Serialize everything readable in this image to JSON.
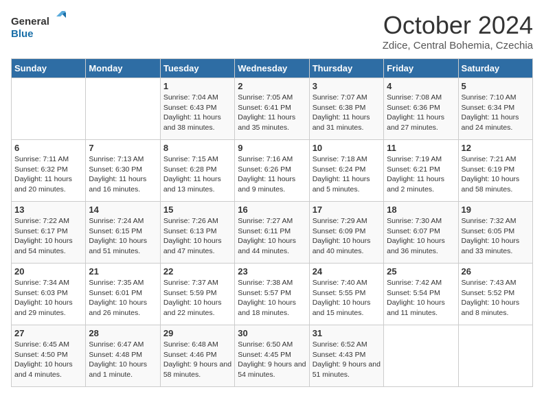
{
  "logo": {
    "general": "General",
    "blue": "Blue"
  },
  "title": "October 2024",
  "subtitle": "Zdice, Central Bohemia, Czechia",
  "days_of_week": [
    "Sunday",
    "Monday",
    "Tuesday",
    "Wednesday",
    "Thursday",
    "Friday",
    "Saturday"
  ],
  "weeks": [
    [
      null,
      null,
      {
        "day": 1,
        "sunrise": "7:04 AM",
        "sunset": "6:43 PM",
        "daylight": "11 hours and 38 minutes."
      },
      {
        "day": 2,
        "sunrise": "7:05 AM",
        "sunset": "6:41 PM",
        "daylight": "11 hours and 35 minutes."
      },
      {
        "day": 3,
        "sunrise": "7:07 AM",
        "sunset": "6:38 PM",
        "daylight": "11 hours and 31 minutes."
      },
      {
        "day": 4,
        "sunrise": "7:08 AM",
        "sunset": "6:36 PM",
        "daylight": "11 hours and 27 minutes."
      },
      {
        "day": 5,
        "sunrise": "7:10 AM",
        "sunset": "6:34 PM",
        "daylight": "11 hours and 24 minutes."
      }
    ],
    [
      {
        "day": 6,
        "sunrise": "7:11 AM",
        "sunset": "6:32 PM",
        "daylight": "11 hours and 20 minutes."
      },
      {
        "day": 7,
        "sunrise": "7:13 AM",
        "sunset": "6:30 PM",
        "daylight": "11 hours and 16 minutes."
      },
      {
        "day": 8,
        "sunrise": "7:15 AM",
        "sunset": "6:28 PM",
        "daylight": "11 hours and 13 minutes."
      },
      {
        "day": 9,
        "sunrise": "7:16 AM",
        "sunset": "6:26 PM",
        "daylight": "11 hours and 9 minutes."
      },
      {
        "day": 10,
        "sunrise": "7:18 AM",
        "sunset": "6:24 PM",
        "daylight": "11 hours and 5 minutes."
      },
      {
        "day": 11,
        "sunrise": "7:19 AM",
        "sunset": "6:21 PM",
        "daylight": "11 hours and 2 minutes."
      },
      {
        "day": 12,
        "sunrise": "7:21 AM",
        "sunset": "6:19 PM",
        "daylight": "10 hours and 58 minutes."
      }
    ],
    [
      {
        "day": 13,
        "sunrise": "7:22 AM",
        "sunset": "6:17 PM",
        "daylight": "10 hours and 54 minutes."
      },
      {
        "day": 14,
        "sunrise": "7:24 AM",
        "sunset": "6:15 PM",
        "daylight": "10 hours and 51 minutes."
      },
      {
        "day": 15,
        "sunrise": "7:26 AM",
        "sunset": "6:13 PM",
        "daylight": "10 hours and 47 minutes."
      },
      {
        "day": 16,
        "sunrise": "7:27 AM",
        "sunset": "6:11 PM",
        "daylight": "10 hours and 44 minutes."
      },
      {
        "day": 17,
        "sunrise": "7:29 AM",
        "sunset": "6:09 PM",
        "daylight": "10 hours and 40 minutes."
      },
      {
        "day": 18,
        "sunrise": "7:30 AM",
        "sunset": "6:07 PM",
        "daylight": "10 hours and 36 minutes."
      },
      {
        "day": 19,
        "sunrise": "7:32 AM",
        "sunset": "6:05 PM",
        "daylight": "10 hours and 33 minutes."
      }
    ],
    [
      {
        "day": 20,
        "sunrise": "7:34 AM",
        "sunset": "6:03 PM",
        "daylight": "10 hours and 29 minutes."
      },
      {
        "day": 21,
        "sunrise": "7:35 AM",
        "sunset": "6:01 PM",
        "daylight": "10 hours and 26 minutes."
      },
      {
        "day": 22,
        "sunrise": "7:37 AM",
        "sunset": "5:59 PM",
        "daylight": "10 hours and 22 minutes."
      },
      {
        "day": 23,
        "sunrise": "7:38 AM",
        "sunset": "5:57 PM",
        "daylight": "10 hours and 18 minutes."
      },
      {
        "day": 24,
        "sunrise": "7:40 AM",
        "sunset": "5:55 PM",
        "daylight": "10 hours and 15 minutes."
      },
      {
        "day": 25,
        "sunrise": "7:42 AM",
        "sunset": "5:54 PM",
        "daylight": "10 hours and 11 minutes."
      },
      {
        "day": 26,
        "sunrise": "7:43 AM",
        "sunset": "5:52 PM",
        "daylight": "10 hours and 8 minutes."
      }
    ],
    [
      {
        "day": 27,
        "sunrise": "6:45 AM",
        "sunset": "4:50 PM",
        "daylight": "10 hours and 4 minutes."
      },
      {
        "day": 28,
        "sunrise": "6:47 AM",
        "sunset": "4:48 PM",
        "daylight": "10 hours and 1 minute."
      },
      {
        "day": 29,
        "sunrise": "6:48 AM",
        "sunset": "4:46 PM",
        "daylight": "9 hours and 58 minutes."
      },
      {
        "day": 30,
        "sunrise": "6:50 AM",
        "sunset": "4:45 PM",
        "daylight": "9 hours and 54 minutes."
      },
      {
        "day": 31,
        "sunrise": "6:52 AM",
        "sunset": "4:43 PM",
        "daylight": "9 hours and 51 minutes."
      },
      null,
      null
    ]
  ]
}
